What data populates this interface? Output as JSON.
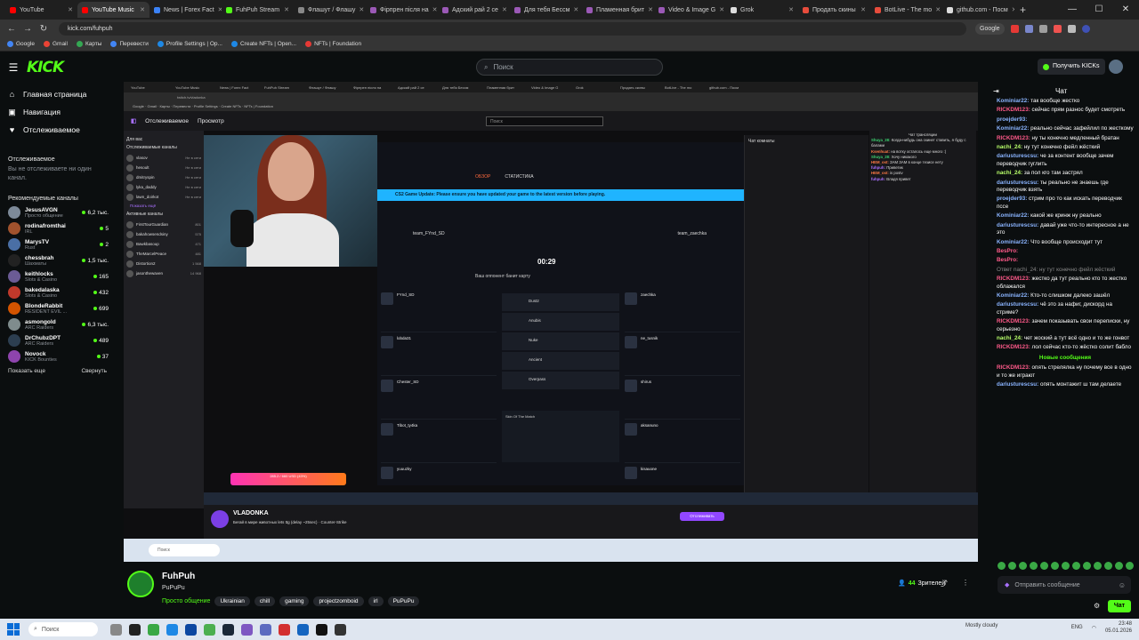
{
  "browser": {
    "tabs": [
      {
        "label": "YouTube",
        "color": "#ff0000",
        "active": false
      },
      {
        "label": "YouTube Music",
        "color": "#ff0000",
        "active": true
      },
      {
        "label": "News | Forex Fact",
        "color": "#3b82f6",
        "active": false
      },
      {
        "label": "FuhPuh Stream",
        "color": "#53fc18",
        "active": false
      },
      {
        "label": "Флашут / Флашу",
        "color": "#888888",
        "active": false
      },
      {
        "label": "Фірпрен після на",
        "color": "#9b59b6",
        "active": false
      },
      {
        "label": "Адский рай 2 се",
        "color": "#9b59b6",
        "active": false
      },
      {
        "label": "Для тебя Бессм",
        "color": "#9b59b6",
        "active": false
      },
      {
        "label": "Пламенная брит",
        "color": "#9b59b6",
        "active": false
      },
      {
        "label": "Video & Image G",
        "color": "#9b59b6",
        "active": false
      },
      {
        "label": "Grok",
        "color": "#dddddd",
        "active": false
      },
      {
        "label": "Продать скины",
        "color": "#e74c3c",
        "active": false
      },
      {
        "label": "BotLive - The mo",
        "color": "#e74c3c",
        "active": false
      },
      {
        "label": "github.com - Посм",
        "color": "#dddddd",
        "active": false
      }
    ],
    "url": "kick.com/fuhpuh",
    "google_label": "Google",
    "bookmarks": [
      "Google",
      "Gmail",
      "Карты",
      "Перевести",
      "Profile Settings | Op...",
      "Create NFTs | Open...",
      "NFTs | Foundation"
    ]
  },
  "kick_header": {
    "logo": "KICK",
    "search_placeholder": "Поиск",
    "get_kicks": "Получить KICKs"
  },
  "sidebar": {
    "nav": [
      {
        "icon": "⌂",
        "label": "Главная страница"
      },
      {
        "icon": "▣",
        "label": "Навигация"
      },
      {
        "icon": "♥",
        "label": "Отслеживаемое"
      }
    ],
    "followed_heading": "Отслеживаемое",
    "followed_empty": "Вы не отслеживаете ни один канал.",
    "recommended_heading": "Рекомендуемые каналы",
    "channels": [
      {
        "name": "JesusAVGN",
        "category": "Просто общение",
        "viewers": "6,2 тыс.",
        "color": "#7d8a99"
      },
      {
        "name": "rodinafromthai",
        "category": "IRL",
        "viewers": "5",
        "color": "#a0522d"
      },
      {
        "name": "MarysTV",
        "category": "Rust",
        "viewers": "2",
        "color": "#4a6fa5"
      },
      {
        "name": "chessbrah",
        "category": "Шахматы",
        "viewers": "1,5 тыс.",
        "color": "#222222"
      },
      {
        "name": "keithlocks",
        "category": "Slots & Casino",
        "viewers": "165",
        "color": "#6b5b95"
      },
      {
        "name": "bakedalaska",
        "category": "Slots & Casino",
        "viewers": "432",
        "color": "#c0392b"
      },
      {
        "name": "BlondeRabbit",
        "category": "RESIDENT EVIL ...",
        "viewers": "699",
        "color": "#d35400"
      },
      {
        "name": "asmongold",
        "category": "ARC Raiders",
        "viewers": "6,3 тыс.",
        "color": "#7f8c8d"
      },
      {
        "name": "DrChubzDPT",
        "category": "ARC Raiders",
        "viewers": "489",
        "color": "#2c3e50"
      },
      {
        "name": "Novock",
        "category": "KICK Bounties",
        "viewers": "37",
        "color": "#8e44ad"
      }
    ],
    "show_more": "Показать еще",
    "collapse": "Свернуть"
  },
  "player": {
    "inner_url": "twitch.tv/vladonka",
    "twitch_nav": [
      "Отслеживаемое",
      "Просмотр"
    ],
    "twitch_search": "Поиск",
    "twitch_sidebar_heading": "Для вас",
    "twitch_followed_heading": "Отслеживаемые каналы",
    "twitch_followed": [
      {
        "name": "vlasov",
        "status": "Не в сети"
      },
      {
        "name": "hesoult",
        "status": "Не в сети"
      },
      {
        "name": "dmitryspin",
        "status": "Не в сети"
      },
      {
        "name": "lyka_daddy",
        "status": "Не в сети"
      },
      {
        "name": "lawn_doirkot",
        "status": "Не в сети"
      }
    ],
    "twitch_show_more": "Показать ещё",
    "twitch_live_heading": "Активные каналы",
    "twitch_live": [
      {
        "name": "FirstTourGuardian",
        "status": "801"
      },
      {
        "name": "bakahowsendsiny",
        "status": "575"
      },
      {
        "name": "Bawkbasoup",
        "status": "471"
      },
      {
        "name": "TheMarcelPeace",
        "status": "481"
      },
      {
        "name": "Distortion2",
        "status": "1 568"
      },
      {
        "name": "jasonthewaven",
        "status": "14 968"
      }
    ],
    "game_tabs": [
      "ОБЗОР",
      "СТАТИСТИКА"
    ],
    "game_banner": "CS2 Game Update: Please ensure you have updated your game to the latest version before playing.",
    "team_left": "team_FYnd_SD",
    "team_right": "team_zaechka",
    "timer": "00:29",
    "veto_header": "Ваш оппонент банит карту",
    "maps": [
      "Dust2",
      "Anubis",
      "Nuke",
      "Ancient",
      "Overpass"
    ],
    "players_left": [
      "FYnd_SD",
      "lobda31",
      "Chester_SD",
      "Tibot_ty4ka",
      "yuuuzky"
    ],
    "players_right": [
      "zaechka",
      "ne_tusnik",
      "shirus",
      "aksanuno",
      "kisauone"
    ],
    "knife_label": "Skin Of The Match",
    "chat_pane_title": "Чат комнаты",
    "stream_chat_title": "Чат трансляции",
    "stream_chat": [
      {
        "user": "Shuya_28:",
        "text": "Когда-нибудь она скинет ставить, я буду с балами"
      },
      {
        "user": "Ksenhuat:",
        "text": "на вотку осталось еще много :("
      },
      {
        "user": "Shuya_28:",
        "text": "Хочу никакого"
      },
      {
        "user": "HEM_ost:",
        "text": "ЗАМ ЗАМ в конце тезисе нету"
      },
      {
        "user": "fuhpuh:",
        "text": "Приветик"
      },
      {
        "user": "HEM_ost:",
        "text": "is postv"
      },
      {
        "user": "fuhpuh:",
        "text": "Владя привет"
      }
    ],
    "donation": "285.2 / 660 USD (43%)",
    "streamer": "VLADONKA",
    "stream_title": "Бегай в мире животных lets ttg (delay ~25sec)",
    "stream_category": "Counter-Strike",
    "follow": "Отслеживать",
    "win_search": "Поиск"
  },
  "chat": {
    "title": "Чат",
    "messages": [
      {
        "user": "Kominiar22:",
        "text": "так вообще жестко",
        "color": "#8ab4ff"
      },
      {
        "user": "RICKDM123:",
        "text": "сейчас прям разнос будет смотреть",
        "color": "#ff5a8a"
      },
      {
        "user": "proejder93:",
        "text": "",
        "color": "#8ab4ff"
      },
      {
        "user": "Kominiar22:",
        "text": "реально сейчас зафейлил по жесткому",
        "color": "#8ab4ff"
      },
      {
        "user": "RICKDM123:",
        "text": "ну ты конечно медленный братан",
        "color": "#ff5a8a"
      },
      {
        "user": "nachi_24:",
        "text": "ну тут конечно фейл жёсткий",
        "color": "#b8ff6a"
      },
      {
        "user": "dariusturescsu:",
        "text": "че за контент вообще зачем переводчик гуглить",
        "color": "#8ab4ff"
      },
      {
        "user": "nachi_24:",
        "text": "за пол кго там застрял",
        "color": "#b8ff6a"
      },
      {
        "user": "dariusturescsu:",
        "text": "ты реально не знаешь где переводчик взять",
        "color": "#8ab4ff"
      },
      {
        "user": "proejder93:",
        "text": "стрим про то как искать переводчик пссе",
        "color": "#8ab4ff"
      },
      {
        "user": "Kominiar22:",
        "text": "какой же кринж ну реально",
        "color": "#8ab4ff"
      },
      {
        "user": "dariusturescsu:",
        "text": "давай уже что-то интересное а не это",
        "color": "#8ab4ff"
      },
      {
        "user": "Kominiar22:",
        "text": "Что вообще происходит тут",
        "color": "#8ab4ff"
      },
      {
        "user": "BesPro:",
        "text": "",
        "color": "#ff5a8a"
      },
      {
        "user": "BesPro:",
        "text": "",
        "color": "#ff5a8a"
      },
      {
        "user": "",
        "text": "Ответ nachi_24: ну тут конечно фейл жёсткий",
        "color": "#888888"
      },
      {
        "user": "RICKDM123:",
        "text": "жестко да тут реально кто то жестко облажался",
        "color": "#ff5a8a"
      },
      {
        "user": "Kominiar22:",
        "text": "Кто-то слишком далеко зашёл",
        "color": "#8ab4ff"
      },
      {
        "user": "dariusturescsu:",
        "text": "чё это за нафиг, дискорд на стриме?",
        "color": "#8ab4ff"
      },
      {
        "user": "RICKDM123:",
        "text": "зачем показывать свои переписки, ну серьезно",
        "color": "#ff5a8a"
      },
      {
        "user": "nachi_24:",
        "text": "чет жоский а тут всё одно и то же гонвот",
        "color": "#b8ff6a"
      },
      {
        "user": "RICKDM123:",
        "text": "лол сейчас кто-то жёстко солит бабло",
        "color": "#ff5a8a"
      }
    ],
    "new_messages": "Новые сообщения",
    "messages_after": [
      {
        "user": "RICKDM123:",
        "text": "опять стрелялка ну почему все в одно и то же играют",
        "color": "#ff5a8a"
      },
      {
        "user": "dariusturescsu:",
        "text": "опять монтажит ш там делаете",
        "color": "#8ab4ff"
      }
    ],
    "input_placeholder": "Отправить сообщение",
    "send": "Чат"
  },
  "stream": {
    "name": "FuhPuh",
    "subtitle": "PuPuPu",
    "category": "Просто общение",
    "tags": [
      "Ukrainian",
      "chill",
      "gaming",
      "projectzomboid",
      "irl",
      "PuPuPu"
    ],
    "viewer_count": "44",
    "viewer_label": "Зрителей"
  },
  "taskbar": {
    "search": "Поиск",
    "weather": "Mostly cloudy",
    "time": "23:48",
    "date": "05.01.2026",
    "lang": "ENG"
  }
}
